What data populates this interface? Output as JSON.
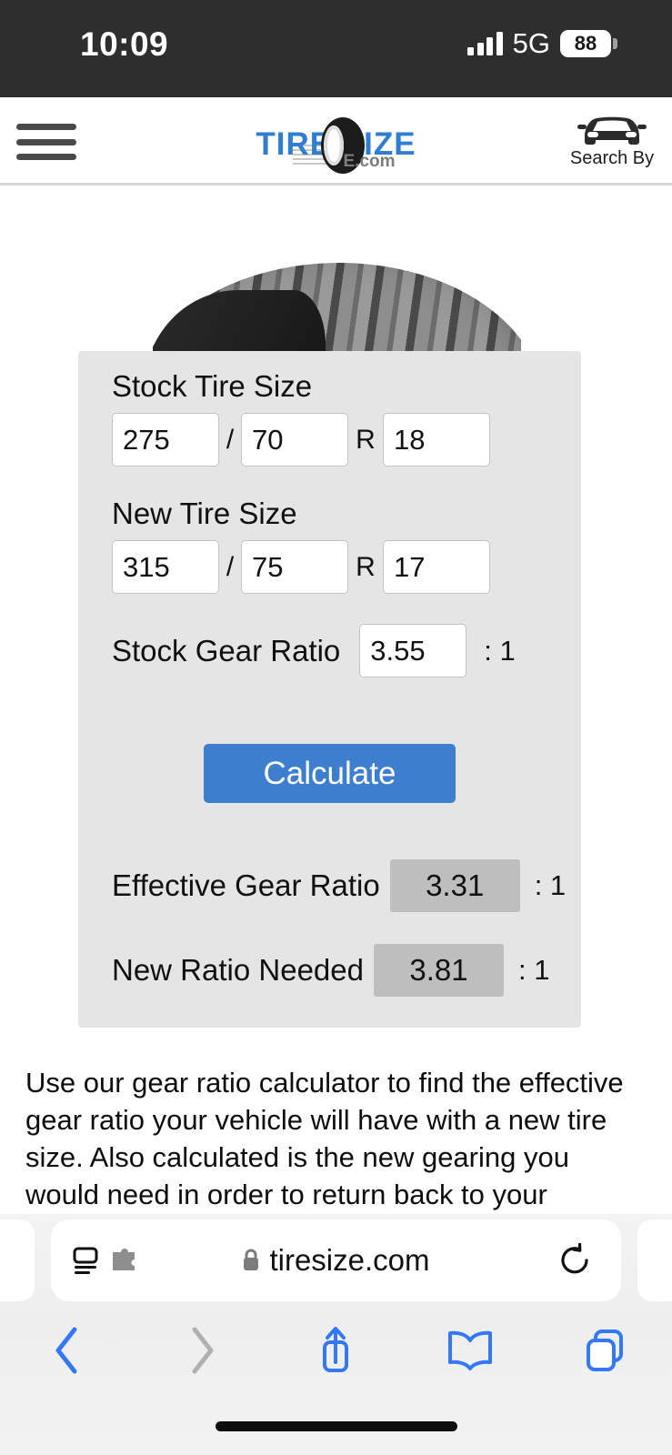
{
  "status_bar": {
    "time": "10:09",
    "network_label": "5G",
    "battery_level": "88",
    "signal_icon": "cellular-signal-icon",
    "battery_icon": "battery-icon"
  },
  "site_header": {
    "menu_icon": "hamburger-menu-icon",
    "logo": {
      "text": "TIRE SIZE",
      "dotcom": "E.com",
      "tire_icon": "tire-logo-icon"
    },
    "search_by": {
      "label": "Search By",
      "icon": "car-front-icon"
    }
  },
  "main": {
    "hero_image_alt": "tire-photo",
    "calculator": {
      "stock_tire": {
        "label": "Stock Tire Size",
        "width": "275",
        "aspect": "70",
        "diameter": "18",
        "separator": "/",
        "radial_prefix": "R"
      },
      "new_tire": {
        "label": "New Tire Size",
        "width": "315",
        "aspect": "75",
        "diameter": "17",
        "separator": "/",
        "radial_prefix": "R"
      },
      "stock_gear_ratio": {
        "label": "Stock Gear Ratio",
        "value": "3.55",
        "suffix": ": 1"
      },
      "calculate_button": "Calculate",
      "results": [
        {
          "label": "Effective Gear Ratio",
          "value": "3.31",
          "suffix": ": 1"
        },
        {
          "label": "New Ratio Needed",
          "value": "3.81",
          "suffix": ": 1"
        }
      ]
    },
    "description": "Use our gear ratio calculator to find the effective gear ratio your vehicle will have with a new tire size. Also calculated is the new gearing you would need in order to return back to your original gear ratio when going to"
  },
  "browser": {
    "url": "tiresize.com",
    "lock_icon": "lock-icon",
    "reader_icon": "reader-view-icon",
    "extensions_icon": "puzzle-extension-icon",
    "reload_icon": "reload-icon",
    "toolbar": [
      {
        "name": "back-button",
        "icon": "chevron-left-icon",
        "enabled": true
      },
      {
        "name": "forward-button",
        "icon": "chevron-right-icon",
        "enabled": false
      },
      {
        "name": "share-button",
        "icon": "share-icon",
        "enabled": true
      },
      {
        "name": "bookmarks-button",
        "icon": "book-icon",
        "enabled": true
      },
      {
        "name": "tabs-button",
        "icon": "tabs-icon",
        "enabled": true
      }
    ]
  },
  "colors": {
    "status_bg": "#2e2e2e",
    "logo_blue": "#2f7ed1",
    "panel_bg": "#e5e5e5",
    "button_blue": "#3d7fce",
    "result_bg": "#bebebe",
    "safari_blue": "#3478f6"
  }
}
